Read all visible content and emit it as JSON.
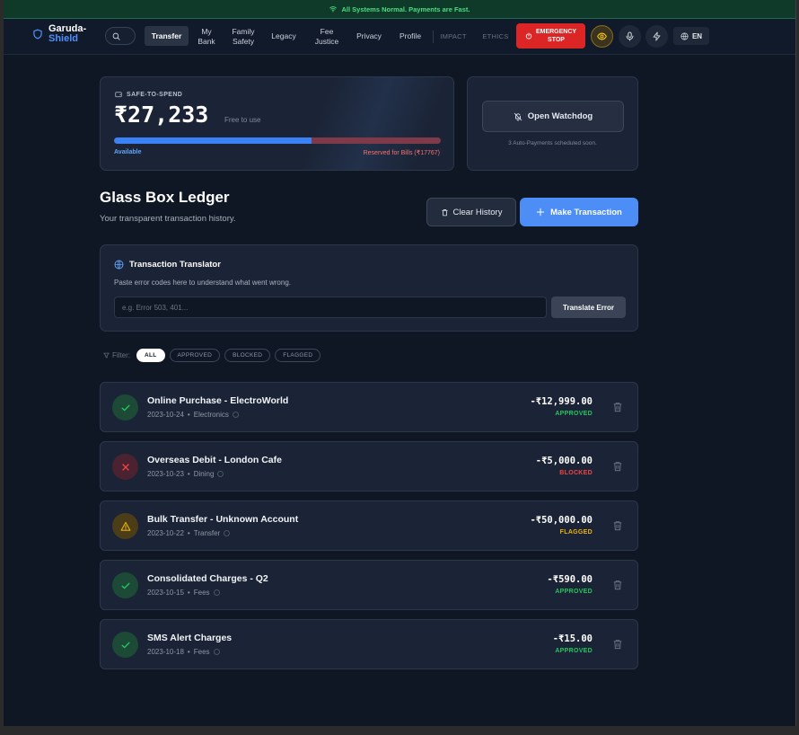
{
  "status_bar": {
    "text": "All Systems Normal. Payments are Fast."
  },
  "brand": {
    "line1": "Garuda-",
    "line2": "Shield"
  },
  "nav": {
    "items": [
      {
        "label": "Transfer",
        "active": true
      },
      {
        "label": "My\nBank"
      },
      {
        "label": "Family\nSafety"
      },
      {
        "label": "Legacy"
      },
      {
        "label": "Fee\nJustice"
      },
      {
        "label": "Privacy"
      },
      {
        "label": "Profile"
      }
    ],
    "dim_items": [
      "IMPACT",
      "ETHICS"
    ],
    "emergency_label": "EMERGENCY\nSTOP",
    "lang": "EN"
  },
  "safe_to_spend": {
    "label": "SAFE-TO-SPEND",
    "amount": "₹27,233",
    "sub": "Free to use",
    "available_fraction": 0.605,
    "available_label": "Available",
    "reserved_label": "Reserved for Bills (₹17767)"
  },
  "watchdog": {
    "button_label": "Open Watchdog",
    "sub": "3 Auto-Payments scheduled soon."
  },
  "ledger": {
    "title": "Glass Box Ledger",
    "subtitle": "Your transparent transaction history.",
    "clear_label": "Clear History",
    "make_label": "Make Transaction"
  },
  "translator": {
    "title": "Transaction Translator",
    "description": "Paste error codes here to understand what went wrong.",
    "placeholder": "e.g. Error 503, 401...",
    "button_label": "Translate Error"
  },
  "filter": {
    "label": "Filter:",
    "chips": [
      "ALL",
      "APPROVED",
      "BLOCKED",
      "FLAGGED"
    ],
    "active": "ALL"
  },
  "transactions": [
    {
      "name": "Online Purchase - ElectroWorld",
      "date": "2023-10-24",
      "category": "Electronics",
      "amount": "-₹12,999.00",
      "status": "APPROVED",
      "kind": "ok"
    },
    {
      "name": "Overseas Debit - London Cafe",
      "date": "2023-10-23",
      "category": "Dining",
      "amount": "-₹5,000.00",
      "status": "BLOCKED",
      "kind": "bad"
    },
    {
      "name": "Bulk Transfer - Unknown Account",
      "date": "2023-10-22",
      "category": "Transfer",
      "amount": "-₹50,000.00",
      "status": "FLAGGED",
      "kind": "warn"
    },
    {
      "name": "Consolidated Charges - Q2",
      "date": "2023-10-15",
      "category": "Fees",
      "amount": "-₹590.00",
      "status": "APPROVED",
      "kind": "ok"
    },
    {
      "name": "SMS Alert Charges",
      "date": "2023-10-18",
      "category": "Fees",
      "amount": "-₹15.00",
      "status": "APPROVED",
      "kind": "ok"
    }
  ],
  "colors": {
    "accent": "#4c8df6",
    "approved": "#22c55e",
    "blocked": "#ef4444",
    "flagged": "#eab308",
    "emergency": "#dc2626"
  }
}
